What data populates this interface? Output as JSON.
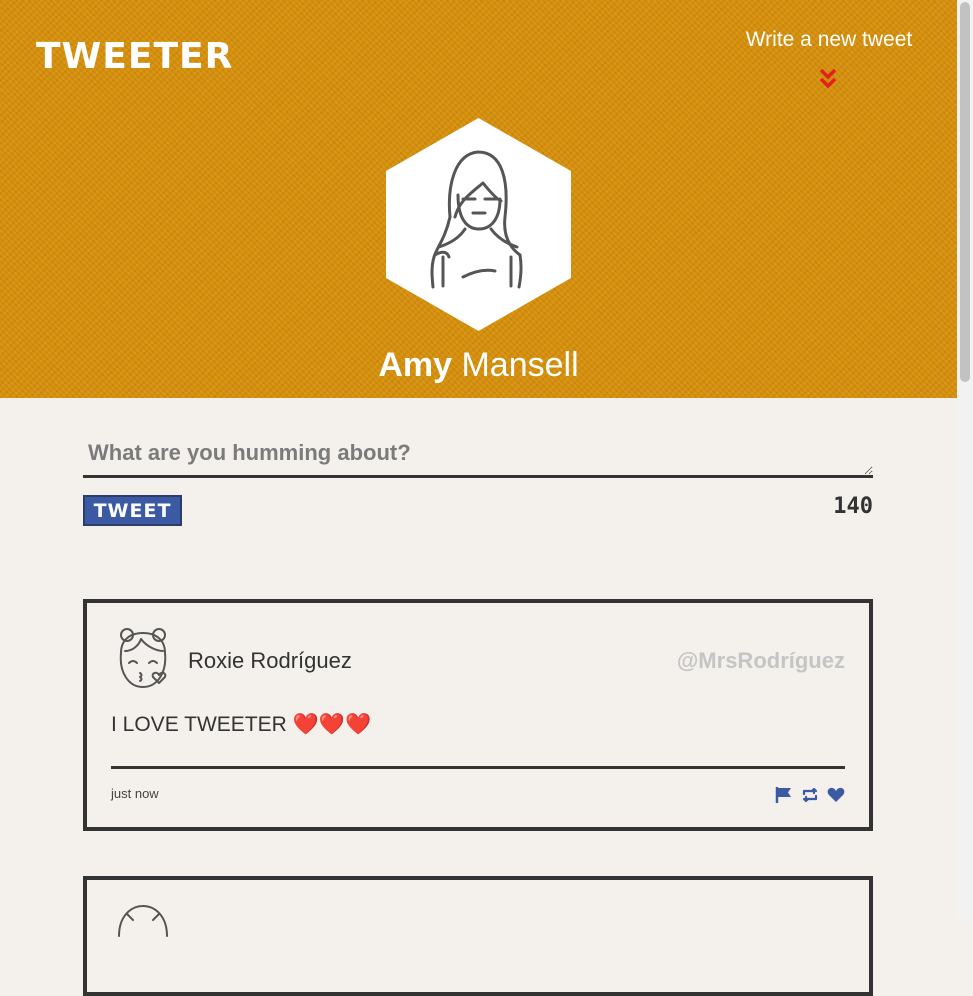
{
  "header": {
    "logo": "TWEETER",
    "compose_toggle": {
      "label": "Write a new tweet",
      "icon": "double-chevron-down-icon",
      "icon_color": "#e2211c"
    },
    "profile": {
      "first_name": "Amy",
      "last_name": "Mansell",
      "avatar": "woman-avatar-icon"
    },
    "background_color": "#d8900a"
  },
  "new_tweet": {
    "placeholder": "What are you humming about?",
    "value": "",
    "submit_label": "TWEET",
    "counter": "140",
    "button_color": "#3b5aa3"
  },
  "tweets": [
    {
      "avatar": "girl-kiss-avatar-icon",
      "name": "Roxie Rodríguez",
      "handle": "@MrsRodríguez",
      "content": "I LOVE TWEETER ❤️❤️❤️",
      "time": "just now",
      "actions": [
        "flag-icon",
        "retweet-icon",
        "heart-icon"
      ],
      "action_color": "#3b5aa3"
    },
    {
      "avatar": "user-avatar-icon"
    }
  ]
}
